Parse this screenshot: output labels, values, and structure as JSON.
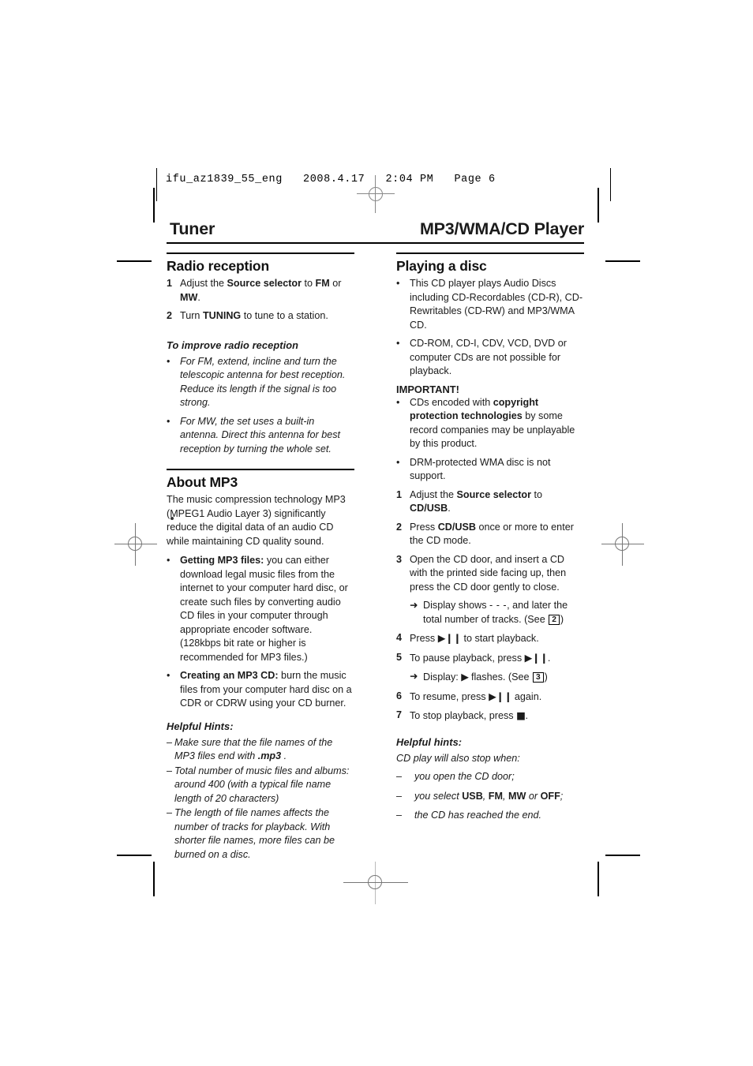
{
  "file_info": "ifu_az1839_55_eng   2008.4.17   2:04 PM   Page 6",
  "running_head": {
    "left": "Tuner",
    "right": "MP3/WMA/CD Player"
  },
  "left_column": {
    "radio_reception": {
      "title": "Radio reception",
      "steps": [
        {
          "num": "1",
          "parts": [
            {
              "t": "Adjust the ",
              "s": "plain"
            },
            {
              "t": "Source selector",
              "s": "bold"
            },
            {
              "t": " to ",
              "s": "plain"
            },
            {
              "t": "FM",
              "s": "bold"
            },
            {
              "t": " or ",
              "s": "plain"
            },
            {
              "t": "MW",
              "s": "bold"
            },
            {
              "t": ".",
              "s": "plain"
            }
          ]
        },
        {
          "num": "2",
          "parts": [
            {
              "t": "Turn ",
              "s": "plain"
            },
            {
              "t": "TUNING",
              "s": "bold"
            },
            {
              "t": " to tune to a station.",
              "s": "plain"
            }
          ]
        }
      ],
      "improve_subhead": "To improve radio reception",
      "improve_bullets": [
        "For FM, extend, incline and turn the telescopic antenna for best reception. Reduce its length if the signal is too strong.",
        "For MW, the set uses a built-in antenna. Direct this antenna for best reception by turning the whole set."
      ]
    },
    "about_mp3": {
      "title": "About MP3",
      "lead": "The music compression technology MP3 (MPEG1 Audio Layer 3) significantly reduce the digital data of an audio CD while maintaining CD quality sound.",
      "bullets": [
        {
          "parts": [
            {
              "t": "Getting MP3 files:",
              "s": "bold"
            },
            {
              "t": " you can either download legal music files from the internet to your computer hard disc, or create such files by converting audio CD files in your computer through appropriate encoder software. (128kbps bit rate or higher is recommended for MP3 files.)",
              "s": "plain"
            }
          ]
        },
        {
          "parts": [
            {
              "t": "Creating an MP3 CD:",
              "s": "bold"
            },
            {
              "t": " burn the music files from your computer hard disc on a CDR or CDRW using your CD burner.",
              "s": "plain"
            }
          ]
        }
      ],
      "hints_subhead": "Helpful Hints:",
      "hints": [
        {
          "parts": [
            {
              "t": "Make sure that the file names of the MP3 files end with ",
              "s": "italic"
            },
            {
              "t": ".mp3",
              "s": "bolditalic"
            },
            {
              "t": " .",
              "s": "italic"
            }
          ]
        },
        {
          "parts": [
            {
              "t": "Total number of music files and albums: around 400 (with a typical file name length of 20 characters)",
              "s": "italic"
            }
          ]
        },
        {
          "parts": [
            {
              "t": "The length of file names affects the number of tracks for playback. With shorter file names, more files can be burned on a disc.",
              "s": "italic"
            }
          ]
        }
      ]
    }
  },
  "right_column": {
    "playing_a_disc": {
      "title": "Playing a disc",
      "intro_bullets": [
        "This CD player plays Audio Discs including CD-Recordables (CD-R), CD-Rewritables (CD-RW) and MP3/WMA CD.",
        "CD-ROM, CD-I, CDV, VCD, DVD or computer CDs are not possible for playback."
      ],
      "important_label": "IMPORTANT!",
      "important_bullets": [
        {
          "parts": [
            {
              "t": "CDs encoded with ",
              "s": "plain"
            },
            {
              "t": "copyright protection technologies",
              "s": "bold"
            },
            {
              "t": " by some record companies may be unplayable by this product.",
              "s": "plain"
            }
          ]
        },
        {
          "parts": [
            {
              "t": "DRM-protected WMA disc is not support.",
              "s": "plain"
            }
          ]
        }
      ],
      "steps": [
        {
          "num": "1",
          "parts": [
            {
              "t": "Adjust the ",
              "s": "plain"
            },
            {
              "t": "Source selector",
              "s": "bold"
            },
            {
              "t": " to ",
              "s": "plain"
            },
            {
              "t": "CD/USB",
              "s": "bold"
            },
            {
              "t": ".",
              "s": "plain"
            }
          ]
        },
        {
          "num": "2",
          "parts": [
            {
              "t": "Press ",
              "s": "plain"
            },
            {
              "t": "CD/USB",
              "s": "bold"
            },
            {
              "t": " once or more to enter the CD mode.",
              "s": "plain"
            }
          ]
        },
        {
          "num": "3",
          "parts": [
            {
              "t": "Open the CD door, and insert a CD with the printed side facing up, then press the CD door gently to close.",
              "s": "plain"
            }
          ]
        },
        {
          "num": "4",
          "parts": [
            {
              "t": "Press ",
              "s": "plain"
            },
            {
              "t": "▶❙❙",
              "s": "sym"
            },
            {
              "t": " to start playback.",
              "s": "plain"
            }
          ]
        },
        {
          "num": "5",
          "parts": [
            {
              "t": "To pause playback, press ",
              "s": "plain"
            },
            {
              "t": "▶❙❙",
              "s": "sym"
            },
            {
              "t": ".",
              "s": "plain"
            }
          ]
        },
        {
          "num": "6",
          "parts": [
            {
              "t": "To resume, press ",
              "s": "plain"
            },
            {
              "t": "▶❙❙",
              "s": "sym"
            },
            {
              "t": " again.",
              "s": "plain"
            }
          ]
        },
        {
          "num": "7",
          "parts": [
            {
              "t": "To stop playback, press ",
              "s": "plain"
            },
            {
              "t": "■",
              "s": "sym"
            },
            {
              "t": ".",
              "s": "plain"
            }
          ]
        }
      ],
      "arrow_after_step3": {
        "prefix": "Display shows ",
        "dashes": "- - -",
        "middle": ", and later the total number of tracks. (See ",
        "refnum": "2",
        "suffix": ")"
      },
      "arrow_after_step5": {
        "prefix": " Display: ",
        "symbol": "▶",
        "middle": " flashes. (See ",
        "refnum": "3",
        "suffix": ")"
      },
      "hints_subhead": "Helpful hints:",
      "hints_lead": "CD play will also stop when:",
      "hints": [
        {
          "parts": [
            {
              "t": "you open the CD door;",
              "s": "italic"
            }
          ]
        },
        {
          "parts": [
            {
              "t": "you select ",
              "s": "italic"
            },
            {
              "t": "USB",
              "s": "bold"
            },
            {
              "t": ", ",
              "s": "italic"
            },
            {
              "t": "FM",
              "s": "bold"
            },
            {
              "t": ", ",
              "s": "italic"
            },
            {
              "t": "MW",
              "s": "bold"
            },
            {
              "t": " or ",
              "s": "italic"
            },
            {
              "t": "OFF",
              "s": "bold"
            },
            {
              "t": ";",
              "s": "italic"
            }
          ]
        },
        {
          "parts": [
            {
              "t": "the CD has reached the end.",
              "s": "italic"
            }
          ]
        }
      ]
    }
  },
  "glyphs": {
    "bullet": "•",
    "dash": "–",
    "arrow": "➜"
  }
}
